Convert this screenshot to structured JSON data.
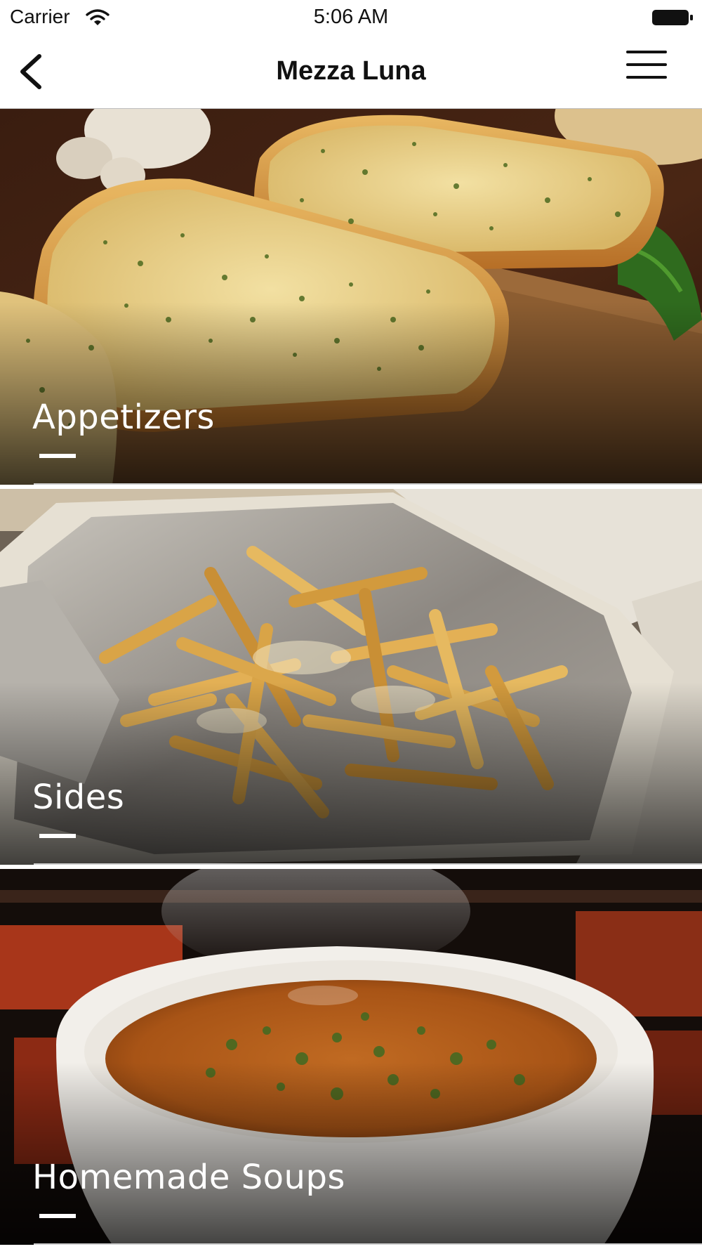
{
  "status_bar": {
    "carrier": "Carrier",
    "time": "5:06 AM"
  },
  "nav": {
    "title": "Mezza Luna",
    "back_icon": "chevron-left-icon",
    "menu_icon": "hamburger-menu-icon"
  },
  "categories": [
    {
      "label": "Appetizers"
    },
    {
      "label": "Sides"
    },
    {
      "label": "Homemade Soups"
    }
  ]
}
